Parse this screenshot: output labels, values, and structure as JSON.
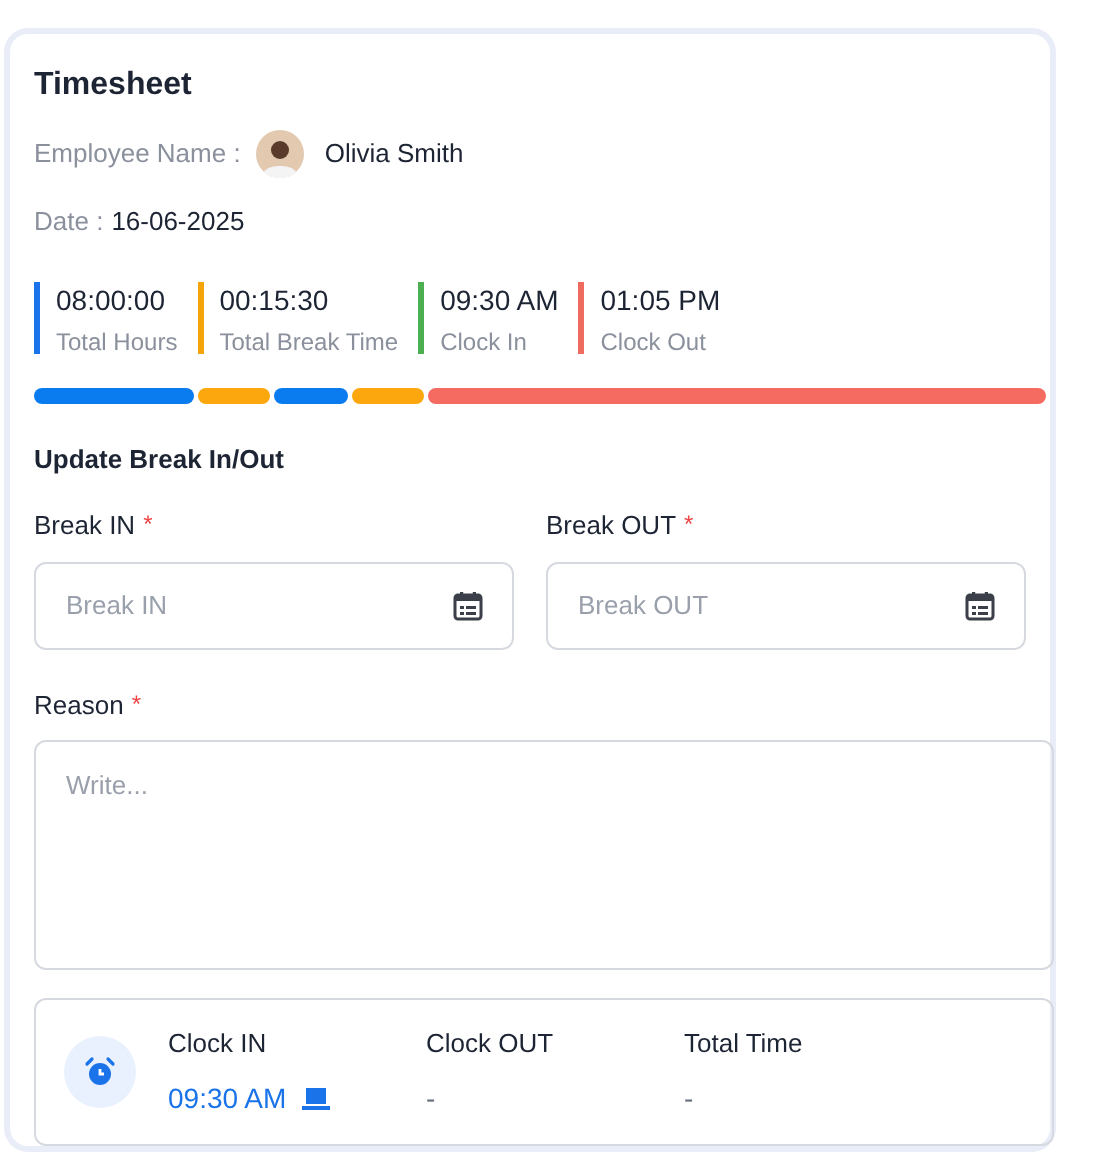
{
  "title": "Timesheet",
  "employee": {
    "label": "Employee Name :",
    "name": "Olivia Smith"
  },
  "date": {
    "label": "Date :",
    "value": "16-06-2025"
  },
  "stats": [
    {
      "value": "08:00:00",
      "label": "Total Hours",
      "color": "#1a73e8"
    },
    {
      "value": "00:15:30",
      "label": "Total Break Time",
      "color": "#f4a40b"
    },
    {
      "value": "09:30 AM",
      "label": "Clock In",
      "color": "#4caf50"
    },
    {
      "value": "01:05 PM",
      "label": "Clock Out",
      "color": "#f06b5f"
    }
  ],
  "timeline": [
    {
      "color": "#0b7bf0"
    },
    {
      "color": "#fba70d"
    },
    {
      "color": "#0b7bf0"
    },
    {
      "color": "#fba70d"
    },
    {
      "color": "#f56b62"
    }
  ],
  "section_title": "Update Break In/Out",
  "fields": [
    {
      "label": "Break IN",
      "required": "*",
      "placeholder": "Break IN"
    },
    {
      "label": "Break OUT",
      "required": "*",
      "placeholder": "Break OUT"
    }
  ],
  "reason": {
    "label": "Reason",
    "required": "*",
    "placeholder": "Write..."
  },
  "summary": [
    {
      "label": "Clock IN",
      "value": "09:30 AM",
      "highlight": true
    },
    {
      "label": "Clock OUT",
      "value": "-",
      "highlight": false
    },
    {
      "label": "Total Time",
      "value": "-",
      "highlight": false
    }
  ]
}
